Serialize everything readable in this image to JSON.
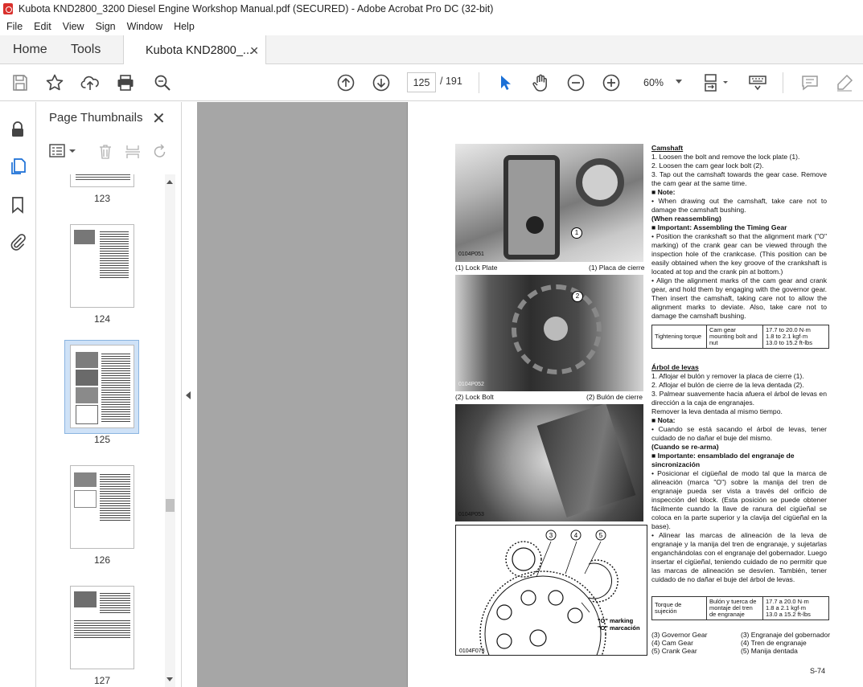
{
  "window": {
    "title": "Kubota KND2800_3200 Diesel Engine Workshop Manual.pdf (SECURED) - Adobe Acrobat Pro DC (32-bit)"
  },
  "menu": [
    "File",
    "Edit",
    "View",
    "Sign",
    "Window",
    "Help"
  ],
  "tabs": {
    "home": "Home",
    "tools": "Tools",
    "document": "Kubota KND2800_...",
    "close_glyph": "✕"
  },
  "toolbar": {
    "current_page": "125",
    "total_pages": "/ 191",
    "zoom": "60%",
    "icons": [
      "save-icon",
      "bookmark-star-icon",
      "upload-icon",
      "print-icon",
      "search-zoom-icon",
      "page-up-icon",
      "page-down-icon",
      "select-cursor-icon",
      "hand-tool-icon",
      "zoom-out-icon",
      "zoom-in-icon",
      "fit-page-icon",
      "keyboard-icon",
      "comment-icon",
      "highlight-icon"
    ]
  },
  "thumbnails": {
    "title": "Page Thumbnails",
    "close_glyph": "✕",
    "pages": [
      "123",
      "124",
      "125",
      "126",
      "127"
    ],
    "selected": "125"
  },
  "page": {
    "number": "S-74",
    "photo_codes": [
      "0104P051",
      "0104P052",
      "0104P053",
      "0104F073"
    ],
    "captions": {
      "p1_left": "(1) Lock Plate",
      "p1_right": "(1) Placa de cierre",
      "p2_left": "(2) Lock Bolt",
      "p2_right": "(2) Bulón de cierre"
    },
    "diagram": {
      "callouts": [
        "3",
        "4",
        "5"
      ],
      "marking_en": "\"O\" marking",
      "marking_es": "\"O\" marcación"
    },
    "en": {
      "heading": "Camshaft",
      "steps": [
        "1. Loosen the bolt and remove the lock plate (1).",
        "2. Loosen the cam gear lock bolt (2).",
        "3. Tap out the camshaft towards the gear case. Remove the cam gear at the same time."
      ],
      "note_label": "■ Note:",
      "note": "• When drawing out the camshaft, take care not to damage the camshaft bushing.",
      "reassembling": "(When reassembling)",
      "important_label": "■ Important: Assembling the Timing Gear",
      "important_1": "• Position the crankshaft so that the alignment mark (\"O\" marking) of the crank gear can be viewed through the inspection hole of the crankcase. (This position can be easily obtained when the key groove of the crankshaft is located at top and the crank pin at bottom.)",
      "important_2": "• Align the alignment marks of the cam gear and crank gear, and hold them by engaging with the governor gear. Then insert the camshaft, taking care not to allow the alignment marks to deviate. Also, take care not to damage the camshaft bushing.",
      "torque": {
        "label": "Tightening torque",
        "item": "Cam gear mounting bolt and nut",
        "values": [
          "17.7 to 20.0 N·m",
          "1.8 to 2.1 kgf·m",
          "13.0 to 15.2 ft-lbs"
        ]
      }
    },
    "es": {
      "heading": "Árbol de levas",
      "steps": [
        "1. Aflojar el bulón y remover la placa de cierre (1).",
        "2. Aflojar el bulón de cierre de la leva dentada (2).",
        "3. Palmear suavemente hacia afuera el árbol de levas en dirección a la caja de engranajes.",
        "Remover la leva dentada al mismo tiempo."
      ],
      "note_label": "■ Nota:",
      "note": "• Cuando se está sacando el árbol de levas, tener cuidado de no dañar el buje del mismo.",
      "reassembling": "(Cuando se re-arma)",
      "important_label": "■ Importante: ensamblado del engranaje de sincronización",
      "important_1": "• Posicionar el cigüeñal de modo tal que la marca de alineación (marca \"O\") sobre la manija del tren de engranaje pueda ser vista a través del orificio de inspección del block. (Esta posición se puede obtener fácilmente cuando la llave de ranura del cigüeñal se coloca en la parte superior y la clavija del cigüeñal en la base).",
      "important_2": "• Alinear las marcas de alineación de la leva de engranaje y la manija del tren de engranaje, y sujetarlas enganchándolas con el engranaje del gobernador. Luego insertar el cigüeñal, teniendo cuidado de no permitir que las marcas de alineación se desvíen. También, tener cuidado de no dañar el buje del árbol de levas.",
      "torque": {
        "label": "Torque de sujeción",
        "item": "Bulón y tuerca de montaje del tren de engranaje",
        "values": [
          "17.7 a 20.0 N·m",
          "1.8 a 2.1 kgf·m",
          "13.0 a 15.2 ft-lbs"
        ]
      }
    },
    "legend_left": [
      "(3) Governor Gear",
      "(4) Cam Gear",
      "(5) Crank Gear"
    ],
    "legend_right": [
      "(3) Engranaje del gobernador",
      "(4) Tren de engranaje",
      "(5) Manija dentada"
    ]
  }
}
